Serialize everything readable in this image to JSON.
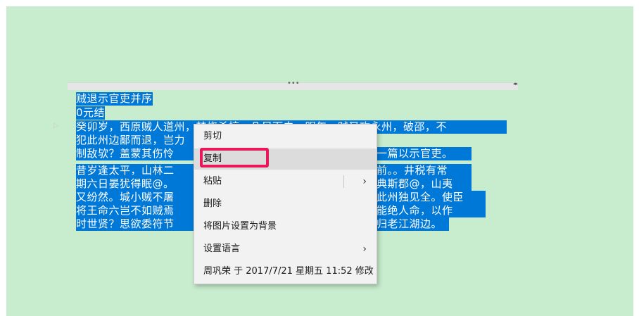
{
  "document": {
    "selected_lines": [
      "贼退示官吏并序",
      "0元结",
      "癸卯岁，西原贼人道州，焚烧杀掠，几尽而去。明年，贼又攻永州，破邵，不",
      "犯此州边鄙而退，岂力",
      "制敌欤？盖蒙其伤怜",
      "昔岁逢太平，山林二",
      "期六日晏犹得眠@。",
      "又纷然。城小贼不屠",
      "将王命六岂不如贼焉",
      "时世贤？思欲委符节",
      "一篇以示官吏。",
      "前。。井税有常",
      "典斯郡@，山夷",
      "此州独见全。使臣",
      "能绝人命，以作",
      "归老江湖边。"
    ]
  },
  "context_menu": {
    "cut": "剪切",
    "copy": "复制",
    "paste": "粘贴",
    "delete": "删除",
    "set_as_background": "将图片设置为背景",
    "set_language": "设置语言",
    "modified_info": "周巩荣 于 2017/7/21 星期五 11:52 修改"
  },
  "colors": {
    "page_background": "#c8ecce",
    "selection": "#0078d7",
    "highlight_border": "#e8195a"
  },
  "icons": {
    "submenu_arrow": "chevron-right-icon",
    "frame_resize": "resize-handle-icon"
  }
}
